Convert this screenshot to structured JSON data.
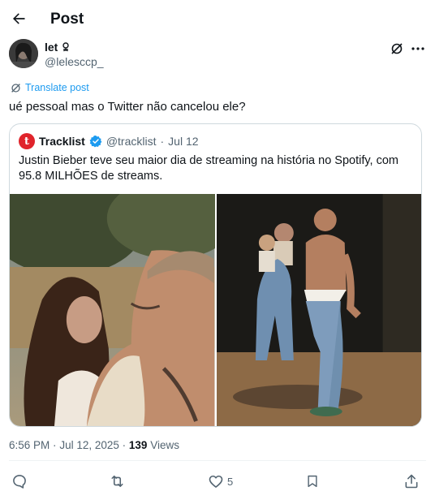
{
  "header": {
    "title": "Post"
  },
  "author": {
    "display_name": "let",
    "handle": "@lelesccp_"
  },
  "translate_label": "Translate post",
  "tweet_text": "ué pessoal mas o Twitter não cancelou ele?",
  "quote": {
    "name": "Tracklist",
    "handle": "@tracklist",
    "separator": "·",
    "date": "Jul 12",
    "avatar_letter": "t",
    "text": "Justin Bieber teve seu maior dia de streaming na história no Spotify, com 95.8 MILHÕES de streams."
  },
  "meta": {
    "time": "6:56 PM",
    "date": "Jul 12, 2025",
    "dot": "·",
    "views_count": "139",
    "views_label": "Views"
  },
  "actions": {
    "like_count": "5"
  },
  "colors": {
    "accent": "#1d9bf0",
    "verified": "#1d9bf0",
    "tracklist_red": "#e0242b",
    "muted": "#536471"
  }
}
